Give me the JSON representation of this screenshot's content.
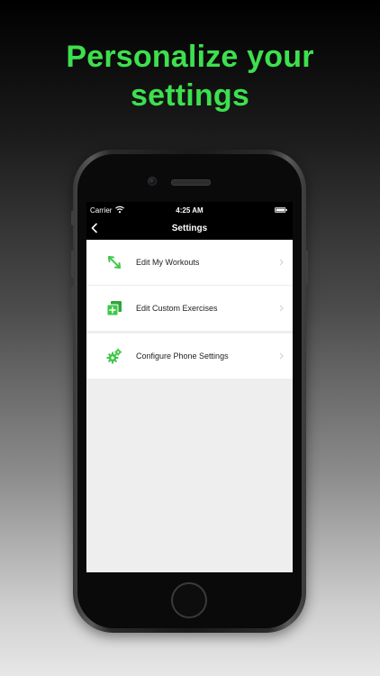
{
  "headline": {
    "line1": "Personalize your",
    "line2": "settings"
  },
  "status_bar": {
    "carrier": "Carrier",
    "time": "4:25 AM",
    "wifi_icon": "wifi-icon",
    "battery_icon": "battery-icon"
  },
  "nav": {
    "title": "Settings",
    "back_icon": "chevron-left-icon"
  },
  "settings_items": [
    {
      "label": "Edit My Workouts",
      "icon": "expand-arrows-icon"
    },
    {
      "label": "Edit Custom Exercises",
      "icon": "add-exercise-icon"
    },
    {
      "label": "Configure Phone Settings",
      "icon": "gears-icon"
    }
  ],
  "colors": {
    "accent": "#3de04e",
    "icon_green": "#3ec84a",
    "screen_background": "#eeeeee"
  }
}
